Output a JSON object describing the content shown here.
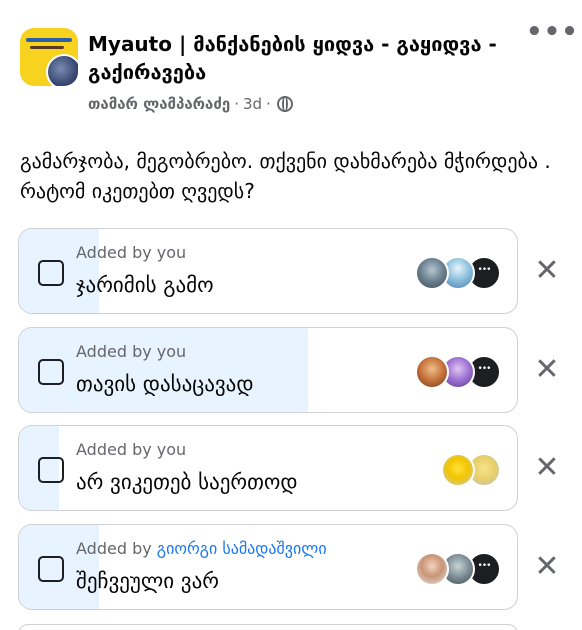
{
  "post": {
    "group_name": "Myauto | მანქანების ყიდვა - გაყიდვა - გაქირავება",
    "author": "თამარ ლამპარაძე",
    "time": "3d",
    "separator": "·",
    "visibility_icon": "globe-icon",
    "more_icon": "more-dots-icon",
    "text": "გამარჯობა, მეგობრებო. თქვენი დახმარება მჭირდება . რატომ იკეთებთ ღვედს?"
  },
  "poll": {
    "options": [
      {
        "added_by_prefix": "Added by you",
        "added_by_name": "",
        "label": "ჯარიმის გამო",
        "vote_share": 0.16,
        "voters": [
          "voter-photo",
          "voter-photo",
          "more-voters"
        ]
      },
      {
        "added_by_prefix": "Added by you",
        "added_by_name": "",
        "label": "თავის დასაცავად",
        "vote_share": 0.58,
        "voters": [
          "voter-photo",
          "voter-photo",
          "more-voters"
        ]
      },
      {
        "added_by_prefix": "Added by you",
        "added_by_name": "",
        "label": "არ ვიკეთებ საერთოდ",
        "vote_share": 0.08,
        "voters": [
          "voter-photo",
          "voter-photo"
        ]
      },
      {
        "added_by_prefix": "Added by",
        "added_by_name": "გიორგი სამადაშვილი",
        "label": "შეჩვეული ვარ",
        "vote_share": 0.16,
        "voters": [
          "voter-photo",
          "voter-photo",
          "more-voters"
        ]
      }
    ]
  },
  "colors": {
    "fill": "#e7f3ff",
    "accent": "#1877f2",
    "secondary_text": "#65676b"
  }
}
